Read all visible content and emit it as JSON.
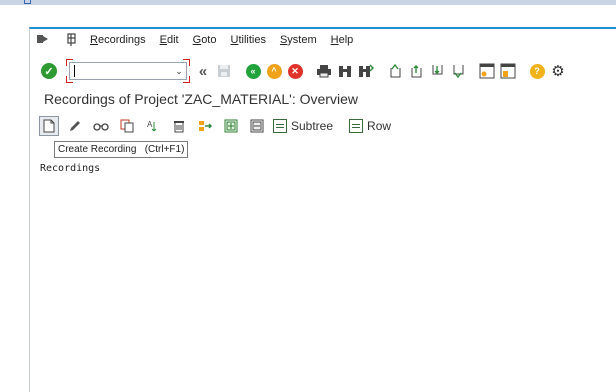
{
  "menu": {
    "items": [
      {
        "label": "Recordings",
        "underline": "R"
      },
      {
        "label": "Edit",
        "underline": "E"
      },
      {
        "label": "Goto",
        "underline": "G"
      },
      {
        "label": "Utilities",
        "underline": "U"
      },
      {
        "label": "System",
        "underline": "S"
      },
      {
        "label": "Help",
        "underline": "H"
      }
    ]
  },
  "command_field": {
    "value": ""
  },
  "page_title": "Recordings of Project 'ZAC_MATERIAL': Overview",
  "app_toolbar": {
    "subtree_label": "Subtree",
    "row_label": "Row"
  },
  "tooltip": "Create Recording   (Ctrl+F1)",
  "content_text": "Recordings",
  "colors": {
    "accent_blue": "#1f8fd0",
    "ok_green": "#2e9a31",
    "nav_green": "#21a23a",
    "nav_orange": "#f0a21b",
    "cancel_red": "#e0312b",
    "help_yellow": "#f2b31a"
  },
  "icons": {
    "menu": [
      "menu-icon",
      "sap-menu-icon"
    ],
    "toolbar": [
      "enter-icon",
      "back-history-icon",
      "save-icon",
      "back-icon",
      "exit-icon",
      "cancel-icon",
      "print-icon",
      "find-icon",
      "find-next-icon",
      "first-page-icon",
      "previous-page-icon",
      "next-page-icon",
      "last-page-icon",
      "create-session-icon",
      "shortcut-icon",
      "help-icon",
      "settings-icon"
    ],
    "app_toolbar": [
      "create-recording-icon",
      "edit-icon",
      "display-icon",
      "copy-icon",
      "rename-icon",
      "delete-icon",
      "export-icon",
      "expand-icon",
      "collapse-icon",
      "subtree-icon",
      "row-icon"
    ]
  }
}
